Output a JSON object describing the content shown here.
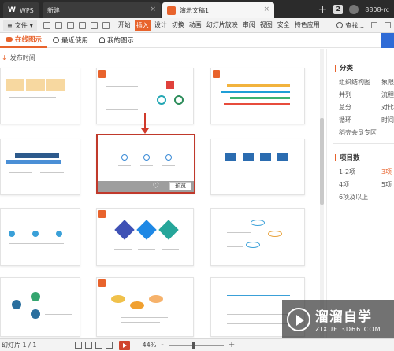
{
  "titlebar": {
    "app_tab": "WPS",
    "new_tab": "新建",
    "doc_tab": "演示文稿1",
    "close_glyph": "×",
    "plus": "+",
    "page_count": "2",
    "user": "8808-rc"
  },
  "ribbon": {
    "file_menu": "文件",
    "file_arrow": "▾",
    "menus": [
      "开始",
      "插入",
      "设计",
      "切换",
      "动画",
      "幻灯片放映",
      "审阅",
      "视图",
      "安全",
      "特色应用"
    ],
    "active_menu": "插入",
    "search": "查找..."
  },
  "subnav": {
    "tabs": [
      "在线图示",
      "最近使用",
      "我的图示"
    ],
    "active_tab": "在线图示"
  },
  "gallery": {
    "sort_label": "发布时间",
    "sort_arrow": "↓",
    "selected_card_action": "预览",
    "heart": "♡"
  },
  "panel": {
    "category_title": "分类",
    "categories_left": [
      "组织结构图",
      "并列",
      "总分",
      "循环",
      "稻壳会员专区"
    ],
    "categories_right": [
      "象限",
      "流程",
      "对比",
      "时间"
    ],
    "count_title": "项目数",
    "counts_left": [
      "1-2项",
      "4项",
      "6项及以上"
    ],
    "counts_right": [
      "3项",
      "5项"
    ],
    "active_count": "3项"
  },
  "statusbar": {
    "slide_info": "幻灯片 1 / 1",
    "zoom": "44%",
    "minus": "-",
    "plus": "+"
  },
  "watermark": {
    "title": "溜溜自学",
    "url": "ZIXUE.3D66.COM"
  },
  "colors": {
    "accent": "#e8632c",
    "selected_border": "#c0392b",
    "arrow": "#d03a2b",
    "titlebar": "#2b2b2b"
  }
}
